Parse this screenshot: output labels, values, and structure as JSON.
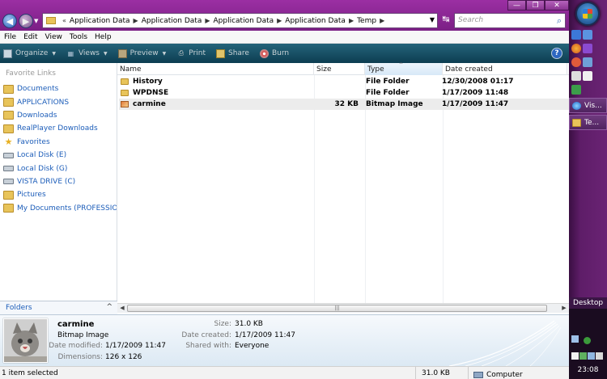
{
  "window": {
    "address": {
      "chevron": "«",
      "crumbs": [
        "Application Data",
        "Application Data",
        "Application Data",
        "Application Data",
        "Temp"
      ]
    },
    "search": {
      "placeholder": "Search"
    },
    "controls": {
      "minimize": "—",
      "maximize": "❐",
      "close": "✕"
    }
  },
  "menu": [
    "File",
    "Edit",
    "View",
    "Tools",
    "Help"
  ],
  "toolbar": {
    "organize": "Organize",
    "views": "Views",
    "preview": "Preview",
    "print": "Print",
    "share": "Share",
    "burn": "Burn",
    "help": "?"
  },
  "navpane": {
    "heading": "Favorite Links",
    "links": [
      {
        "label": "Documents",
        "icon": "folder-icon"
      },
      {
        "label": "APPLICATIONS",
        "icon": "folder-icon"
      },
      {
        "label": "Downloads",
        "icon": "folder-icon"
      },
      {
        "label": "RealPlayer Downloads",
        "icon": "folder-icon"
      },
      {
        "label": "Favorites",
        "icon": "star-icon"
      },
      {
        "label": "Local Disk (E)",
        "icon": "drive-icon"
      },
      {
        "label": "Local Disk (G)",
        "icon": "drive-icon"
      },
      {
        "label": "VISTA DRIVE (C)",
        "icon": "drive-icon"
      },
      {
        "label": "Pictures",
        "icon": "folder-icon"
      },
      {
        "label": "My Documents (PROFESSIO...",
        "icon": "folder-icon"
      }
    ],
    "folders_label": "Folders",
    "folders_chevron": "^"
  },
  "filelist": {
    "columns": {
      "name": "Name",
      "size": "Size",
      "type": "Type",
      "date": "Date created"
    },
    "sort_arrow": "^",
    "rows": [
      {
        "name": "History",
        "size": "",
        "type": "File Folder",
        "date": "12/30/2008 01:17",
        "icon": "folder-icon",
        "selected": false
      },
      {
        "name": "WPDNSE",
        "size": "",
        "type": "File Folder",
        "date": "1/17/2009 11:48",
        "icon": "folder-icon",
        "selected": false
      },
      {
        "name": "carmine",
        "size": "32 KB",
        "type": "Bitmap Image",
        "date": "1/17/2009 11:47",
        "icon": "bitmap-icon",
        "selected": true
      }
    ],
    "scroll_grip": "|||"
  },
  "details": {
    "name": "carmine",
    "type": "Bitmap Image",
    "labels": {
      "modified": "Date modified:",
      "dimensions": "Dimensions:",
      "size": "Size:",
      "created": "Date created:",
      "shared": "Shared with:"
    },
    "values": {
      "modified": "1/17/2009 11:47",
      "dimensions": "126 x 126",
      "size": "31.0 KB",
      "created": "1/17/2009 11:47",
      "shared": "Everyone"
    }
  },
  "status": {
    "selected": "1 item selected",
    "size": "31.0 KB",
    "location": "Computer"
  },
  "taskbar": {
    "buttons": [
      {
        "label": "Vis..."
      },
      {
        "label": "Te..."
      }
    ],
    "desktop": "Desktop",
    "clock": "23:08"
  },
  "colors": {
    "title": "#8a2792",
    "toolbar": "#1b5266",
    "link": "#1c5db9"
  }
}
